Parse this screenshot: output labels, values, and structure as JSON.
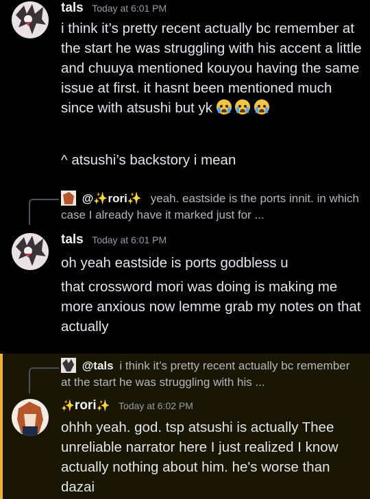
{
  "messages": [
    {
      "author": "tals",
      "timestamp": "Today at 6:01 PM",
      "lines": [
        "i think it’s pretty recent actually bc remember at the start he was struggling with his accent a little and chuuya mentioned kouyou having the same issue at first. it hasnt been mentioned much since with atsushi but yk",
        "^ atsushi’s backstory i mean"
      ],
      "emojis": [
        "loudly-crying-face",
        "loudly-crying-face",
        "loudly-crying-face"
      ]
    },
    {
      "reply_to": {
        "mention": "@",
        "author": "rori",
        "sparkle": "✨",
        "preview": "yeah. eastside is the ports innit. in which case I already have it marked just for ..."
      },
      "author": "tals",
      "timestamp": "Today at 6:01 PM",
      "lines": [
        "oh yeah eastside is ports godbless u",
        "that crossword mori was doing is making me more anxious now lemme grab my notes on that actually"
      ]
    },
    {
      "reply_to": {
        "mention": "@tals",
        "preview": "i think it’s pretty recent actually bc remember at the start he was struggling with his ..."
      },
      "author": "rori",
      "sparkle": "✨",
      "timestamp": "Today at 6:02 PM",
      "lines": [
        "ohhh yeah. god. tsp atsushi is actually Thee unreliable narrator here I just realized I know actually nothing about him. he's worse than dazai"
      ],
      "highlighted": true
    }
  ],
  "colors": {
    "background": "#000000",
    "highlight_bg": "#1a1604",
    "highlight_bar": "#f0b232",
    "text": "#e3e5e8",
    "timestamp": "#9a9ca2"
  }
}
